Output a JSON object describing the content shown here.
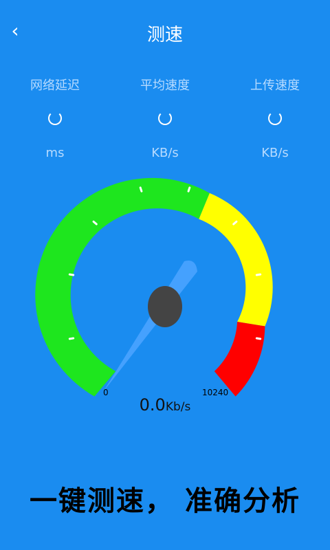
{
  "header": {
    "back_icon": "chevron-left-icon",
    "title": "测速"
  },
  "metrics": [
    {
      "label": "网络延迟",
      "unit": "ms"
    },
    {
      "label": "平均速度",
      "unit": "KB/s"
    },
    {
      "label": "上传速度",
      "unit": "KB/s"
    }
  ],
  "gauge": {
    "min_label": "0",
    "max_label": "10240",
    "value": "0.0",
    "unit": "Kb/s",
    "colors": {
      "green": "#1ee61e",
      "yellow": "#ffff00",
      "red": "#ff0000",
      "hub": "#444444",
      "needle": "#4aa3ff"
    }
  },
  "slogan": "一键测速， 准确分析",
  "theme": {
    "background": "#1a8cf0"
  }
}
